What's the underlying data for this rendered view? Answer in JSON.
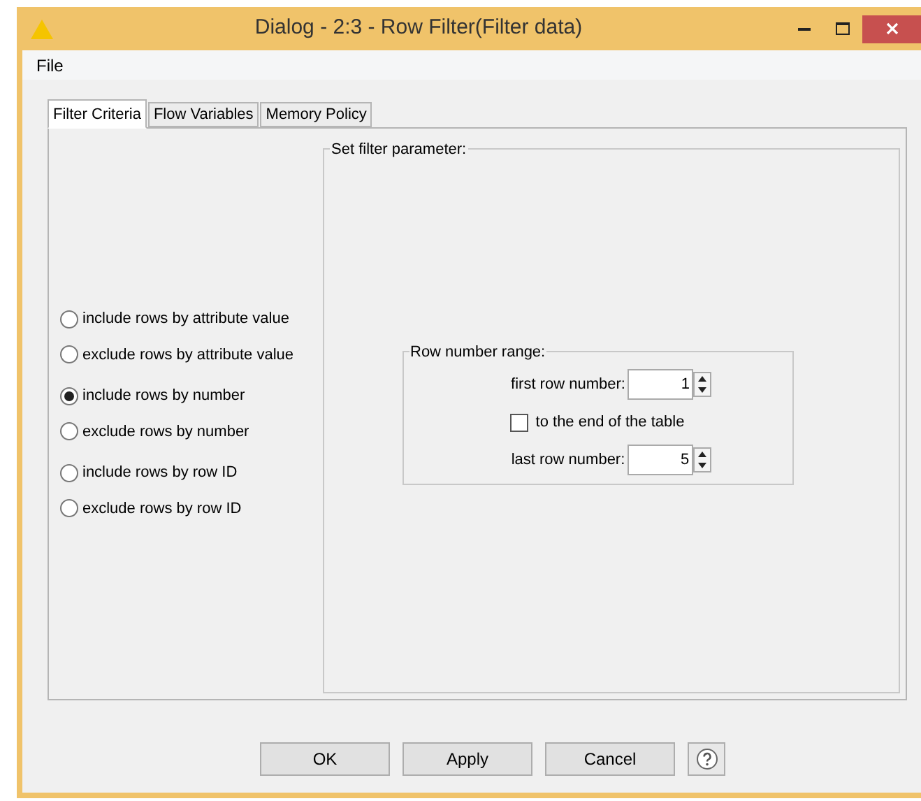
{
  "window": {
    "title": "Dialog - 2:3 - Row Filter(Filter data)"
  },
  "menu": [
    "File"
  ],
  "tabs": [
    {
      "label": "Filter Criteria",
      "selected": true
    },
    {
      "label": "Flow Variables",
      "selected": false
    },
    {
      "label": "Memory Policy",
      "selected": false
    }
  ],
  "options": [
    {
      "label": "include rows by attribute value",
      "selected": false
    },
    {
      "label": "exclude rows by attribute value",
      "selected": false
    },
    {
      "label": "include rows by number",
      "selected": true
    },
    {
      "label": "exclude rows by number",
      "selected": false
    },
    {
      "label": "include rows by row ID",
      "selected": false
    },
    {
      "label": "exclude rows by row ID",
      "selected": false
    }
  ],
  "filter_group": {
    "title": "Set filter parameter:",
    "range_group": {
      "title": "Row number range:",
      "first_label": "first row number:",
      "first_value": "1",
      "to_end": {
        "label": "to the end of the table",
        "checked": false
      },
      "last_label": "last row number:",
      "last_value": "5"
    }
  },
  "buttons": [
    "OK",
    "Apply",
    "Cancel"
  ]
}
